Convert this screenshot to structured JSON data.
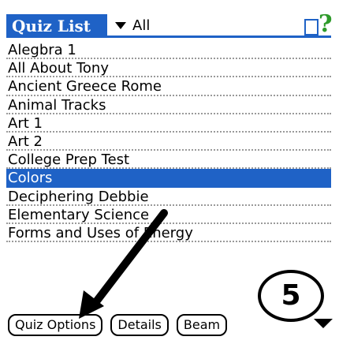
{
  "title": "Quiz List",
  "category": {
    "selected": "All"
  },
  "icons": {
    "device": "device-icon",
    "help": "help-icon"
  },
  "quizzes": [
    "Alegbra 1",
    "All About Tony",
    "Ancient Greece Rome",
    "Animal Tracks",
    "Art 1",
    "Art 2",
    "College Prep Test",
    "Colors",
    "Deciphering Debbie",
    "Elementary Science",
    "Forms and Uses of Energy"
  ],
  "selected_quiz": "Colors",
  "buttons": {
    "quiz_options": "Quiz Options",
    "details": "Details",
    "beam": "Beam"
  },
  "annotation": {
    "step": "5"
  },
  "colors": {
    "accent": "#1f62c6",
    "help": "#2e9a2a"
  }
}
